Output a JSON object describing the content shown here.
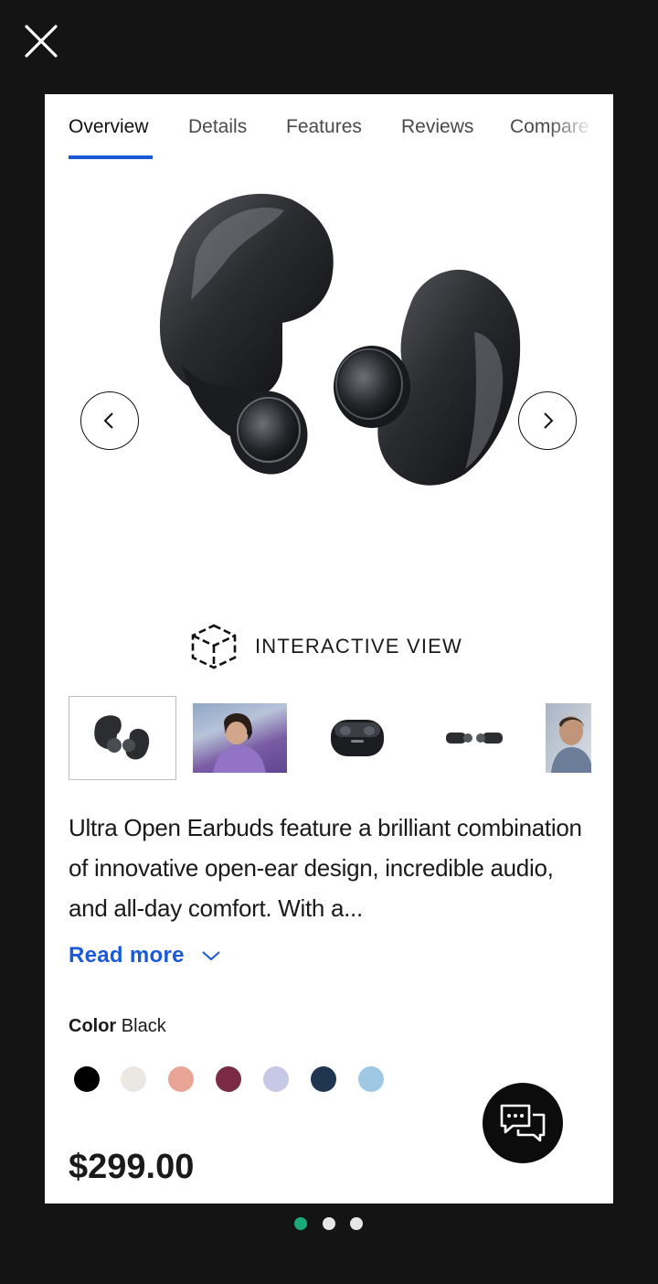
{
  "tabs": [
    {
      "label": "Overview",
      "active": true
    },
    {
      "label": "Details",
      "active": false
    },
    {
      "label": "Features",
      "active": false
    },
    {
      "label": "Reviews",
      "active": false
    },
    {
      "label": "Compare",
      "active": false
    }
  ],
  "hero": {
    "image": "black-open-earbuds",
    "prev_icon": "chevron-left-icon",
    "next_icon": "chevron-right-icon"
  },
  "interactive_view": {
    "label": "INTERACTIVE VIEW",
    "icon": "3d-cube-icon"
  },
  "thumbnails": [
    "earbuds-black",
    "woman-wearing-earbuds",
    "charging-case",
    "earbuds-side-view",
    "man-wearing-earbuds"
  ],
  "description": "Ultra Open Earbuds feature a brilliant combination of innovative open-ear design, incredible audio, and all-day comfort. With a...",
  "read_more": "Read more",
  "color": {
    "label": "Color",
    "value": "Black",
    "swatches": [
      "#000000",
      "#ebe7e2",
      "#e8a595",
      "#7a2a45",
      "#c7c8e6",
      "#1f3550",
      "#9ec8e4"
    ]
  },
  "price": "$299.00",
  "chat_icon": "chat-bubbles-icon",
  "pager": {
    "count": 3,
    "active": 0,
    "active_color": "#1aaa7a",
    "inactive_color": "#e6e6e6"
  },
  "colors": {
    "accent": "#1a5ad6",
    "background": "#141414"
  }
}
